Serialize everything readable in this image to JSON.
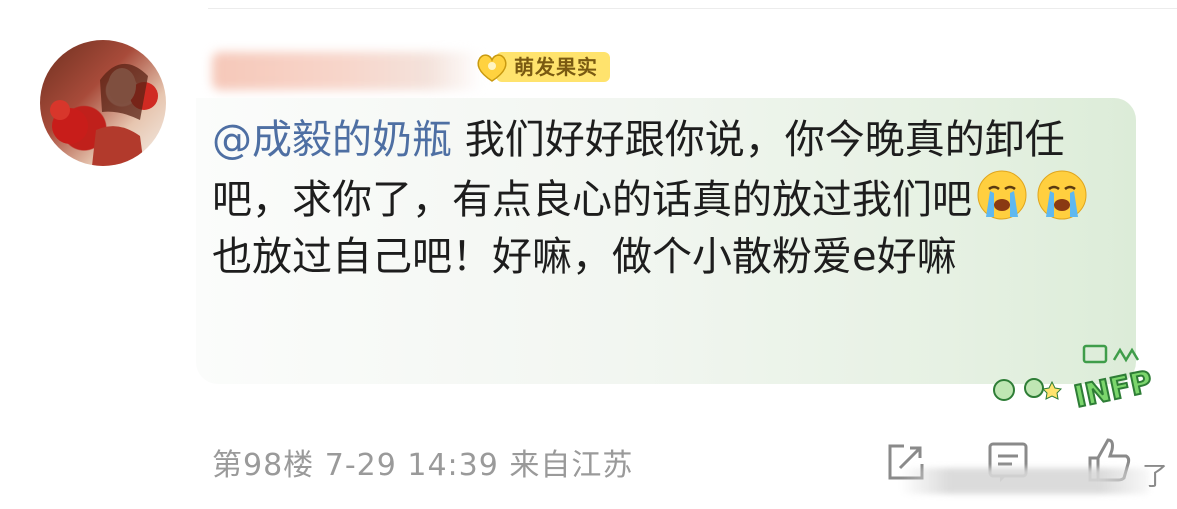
{
  "user": {
    "badge_label": "萌发果实"
  },
  "comment": {
    "mention": "@成毅的奶瓶",
    "text_part1": " 我们好好跟你说，你今晚真的卸任吧，求你了，有点良心的话真的放过我们吧",
    "text_part2": "也放过自己吧！好嘛，做个小散粉爱e好嘛",
    "emojis": [
      "crying-face-icon",
      "crying-face-icon"
    ]
  },
  "sticker": {
    "label": "INFP"
  },
  "meta": {
    "floor": "第98楼",
    "date": "7-29",
    "time": "14:39",
    "location": "来自江苏"
  },
  "watermark": {
    "trailing_char": "了"
  },
  "colors": {
    "mention": "#4e6fa3",
    "badge_bg": "#ffe36d",
    "bubble_tint": "#dcecd8",
    "meta_text": "#9a9a9a"
  }
}
